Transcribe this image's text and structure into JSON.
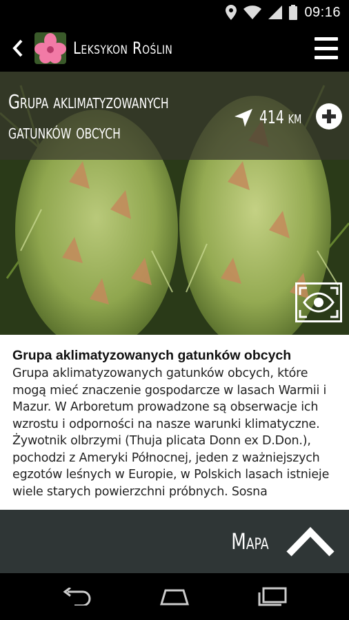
{
  "status_bar": {
    "time": "09:16"
  },
  "app_bar": {
    "title": "Leksykon Roślin"
  },
  "hero": {
    "title_line1": "Grupa aklimatyzowanych",
    "title_line2": "gatunków obcych",
    "distance": "414 km"
  },
  "content": {
    "heading": "Grupa aklimatyzowanych gatunków obcych",
    "body": "Grupa aklimatyzowanych gatunków obcych, które mogą mieć znaczenie gospodarcze w lasach Warmii i Mazur. W Arboretum prowadzone są obserwacje ich wzrostu i odporności na nasze warunki klimatyczne. Żywotnik olbrzymi (Thuja plicata Donn ex D.Don.), pochodzi z Ameryki Północnej, jeden z ważniejszych egzotów leśnych w Europie, w Polskich lasach istnieje wiele starych powierzchni próbnych. Sosna"
  },
  "bottom_bar": {
    "map_label": "Mapa"
  },
  "icons": {
    "back": "chevron-left-icon",
    "menu": "hamburger-menu-icon",
    "navigate": "navigation-arrow-icon",
    "add": "plus-circle-icon",
    "view": "eye-icon",
    "up": "chevron-up-icon"
  },
  "colors": {
    "bottom_bar": "#2f3636",
    "overlay": "#37372d"
  }
}
